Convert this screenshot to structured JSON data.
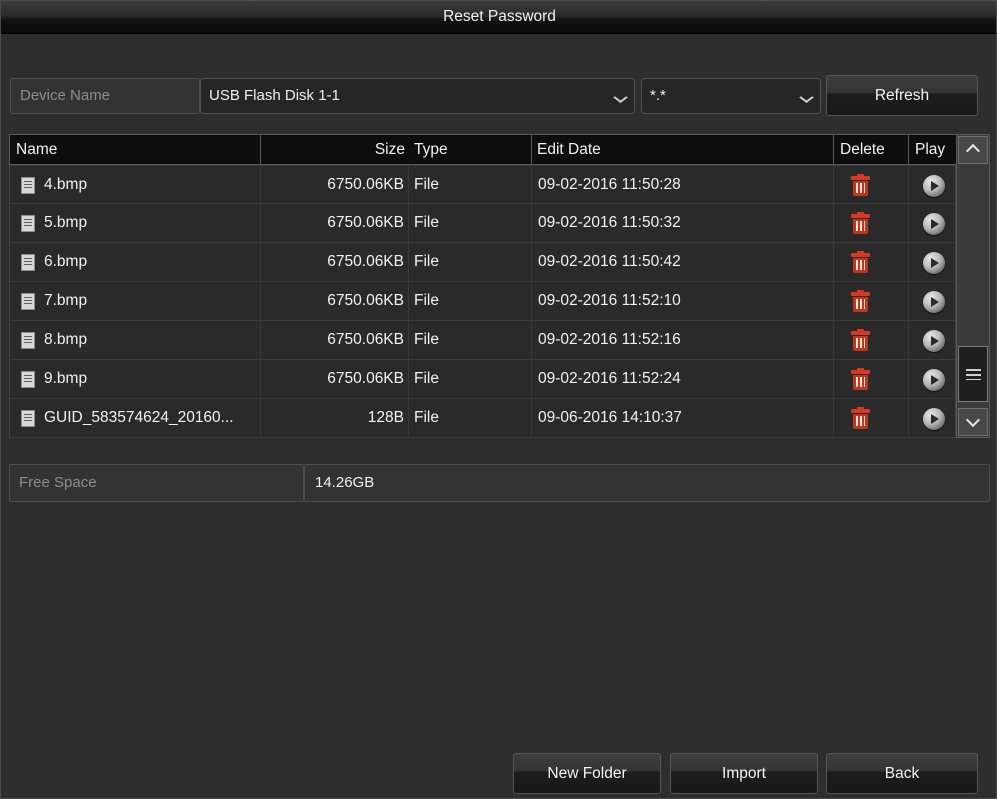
{
  "window": {
    "title": "Reset Password"
  },
  "toolbar": {
    "device_label": "Device Name",
    "device_value": "USB Flash Disk 1-1",
    "filter_value": "*.*",
    "refresh_label": "Refresh"
  },
  "table": {
    "columns": {
      "name": "Name",
      "size": "Size",
      "type": "Type",
      "date": "Edit Date",
      "delete": "Delete",
      "play": "Play"
    },
    "rows": [
      {
        "name": "4.bmp",
        "size": "6750.06KB",
        "type": "File",
        "date": "09-02-2016 11:50:28"
      },
      {
        "name": "5.bmp",
        "size": "6750.06KB",
        "type": "File",
        "date": "09-02-2016 11:50:32"
      },
      {
        "name": "6.bmp",
        "size": "6750.06KB",
        "type": "File",
        "date": "09-02-2016 11:50:42"
      },
      {
        "name": "7.bmp",
        "size": "6750.06KB",
        "type": "File",
        "date": "09-02-2016 11:52:10"
      },
      {
        "name": "8.bmp",
        "size": "6750.06KB",
        "type": "File",
        "date": "09-02-2016 11:52:16"
      },
      {
        "name": "9.bmp",
        "size": "6750.06KB",
        "type": "File",
        "date": "09-02-2016 11:52:24"
      },
      {
        "name": "GUID_583574624_20160...",
        "size": "128B",
        "type": "File",
        "date": "09-06-2016 14:10:37"
      }
    ]
  },
  "freespace": {
    "label": "Free Space",
    "value": "14.26GB"
  },
  "footer": {
    "new_folder_label": "New Folder",
    "import_label": "Import",
    "back_label": "Back"
  },
  "colors": {
    "background": "#2e2e2e",
    "row_background": "#2a2a2a",
    "header_background": "#0d0d0d",
    "text": "#f2f2f2",
    "muted_text": "#8d8d8d",
    "delete_icon": "#c0351e"
  }
}
